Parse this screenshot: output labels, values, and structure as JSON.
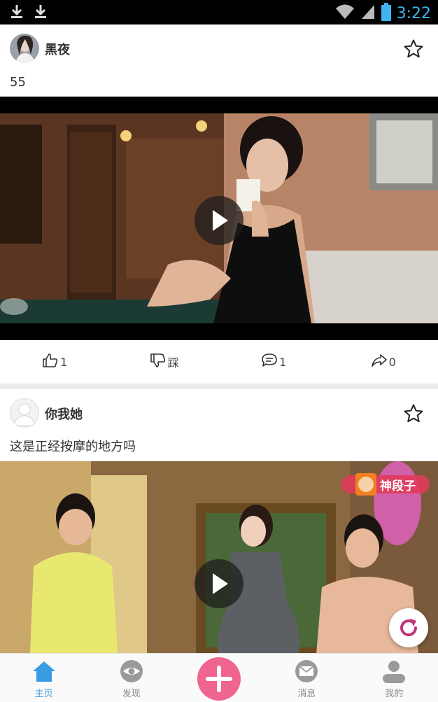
{
  "status_bar": {
    "time": "3:22"
  },
  "posts": [
    {
      "author": "黑夜",
      "text": "55",
      "actions": {
        "like_count": "1",
        "dislike_label": "踩",
        "comment_count": "1",
        "share_count": "0"
      }
    },
    {
      "author": "你我她",
      "text": "这是正经按摩的地方吗",
      "watermark": "神段子"
    }
  ],
  "bottom_nav": {
    "tabs": [
      {
        "label": "主页",
        "icon": "home-icon",
        "active": true
      },
      {
        "label": "发现",
        "icon": "eye-icon"
      },
      {
        "label": "",
        "icon": "plus-icon"
      },
      {
        "label": "消息",
        "icon": "mail-icon"
      },
      {
        "label": "我的",
        "icon": "profile-icon"
      }
    ]
  },
  "colors": {
    "accent": "#3a9be0",
    "add_button": "#f06490",
    "refresh": "#c2347a",
    "time": "#3fb4f0"
  }
}
